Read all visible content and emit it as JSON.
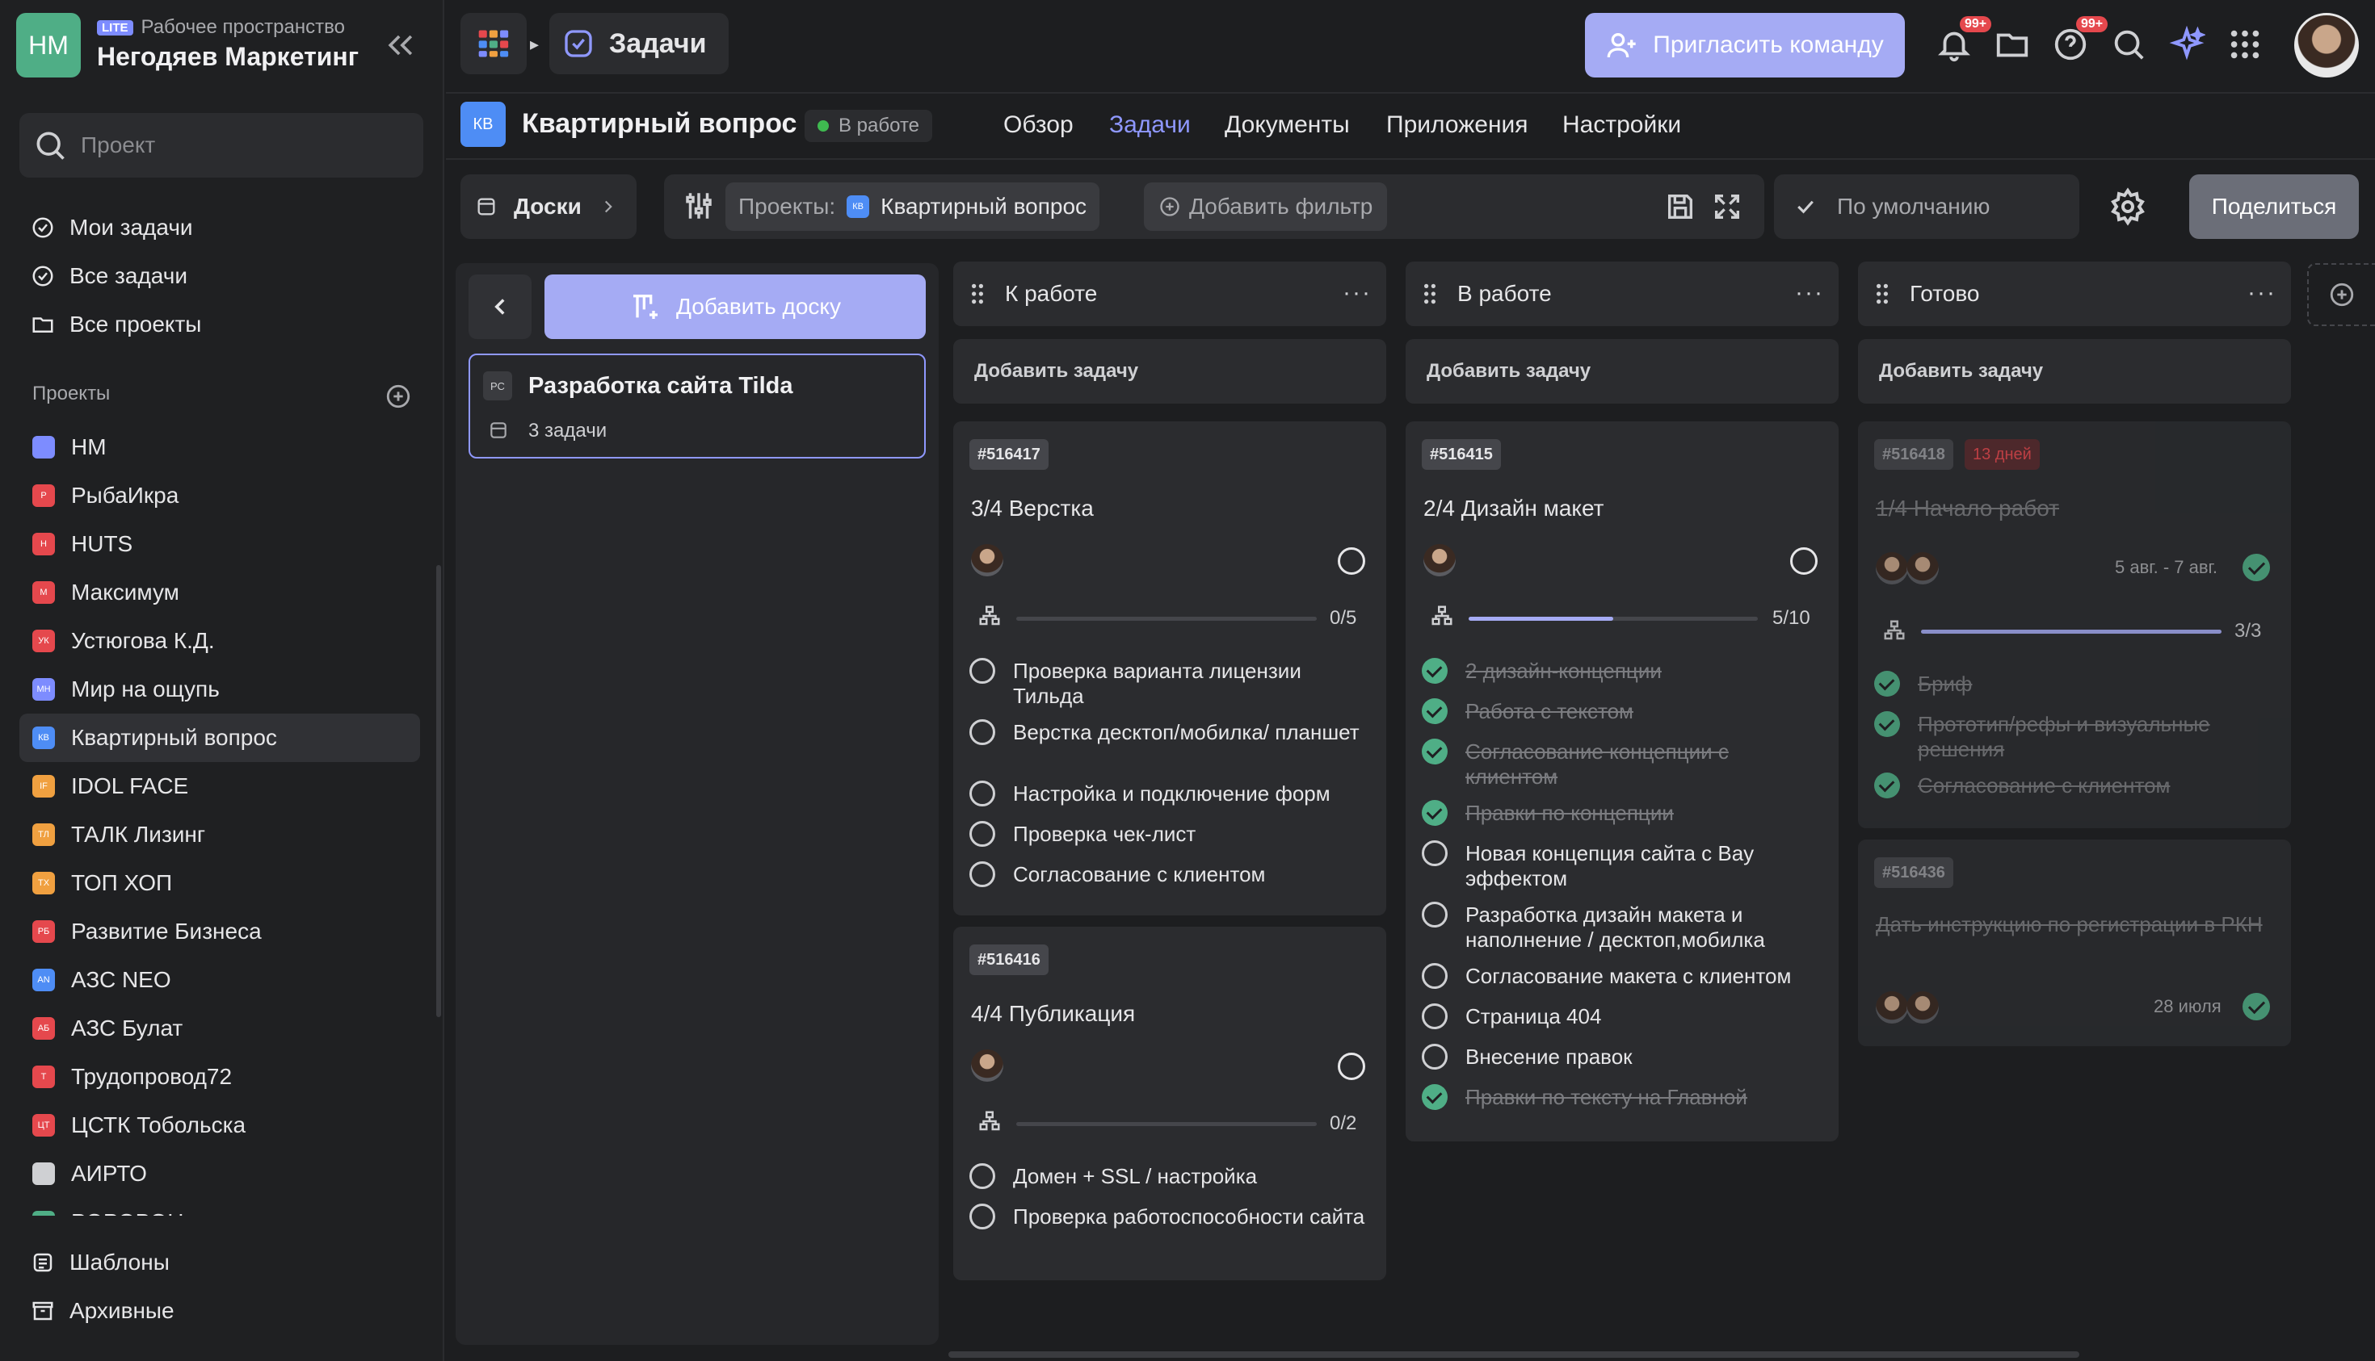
{
  "workspace": {
    "initials": "НМ",
    "badge": "LITE",
    "subtitle": "Рабочее пространство",
    "name": "Негодяев Маркетинг"
  },
  "sidebar": {
    "search_placeholder": "Проект",
    "nav": [
      {
        "label": "Мои задачи",
        "icon": "check-circle-icon"
      },
      {
        "label": "Все задачи",
        "icon": "check-circle-icon"
      },
      {
        "label": "Все проекты",
        "icon": "folder-icon"
      }
    ],
    "projects_heading": "Проекты",
    "projects": [
      {
        "label": "НМ",
        "abbr": "",
        "color": "#7d8cff"
      },
      {
        "label": "РыбаИкра",
        "abbr": "Р",
        "color": "#e5484d"
      },
      {
        "label": "HUTS",
        "abbr": "H",
        "color": "#e5484d"
      },
      {
        "label": "Максимум",
        "abbr": "М",
        "color": "#e5484d"
      },
      {
        "label": "Устюгова К.Д.",
        "abbr": "УК",
        "color": "#e5484d"
      },
      {
        "label": "Мир на ощупь",
        "abbr": "МН",
        "color": "#7d8cff"
      },
      {
        "label": "Квартирный вопрос",
        "abbr": "КВ",
        "color": "#4e8df5",
        "active": true
      },
      {
        "label": "IDOL FACE",
        "abbr": "IF",
        "color": "#f0a040"
      },
      {
        "label": "ТАЛК Лизинг",
        "abbr": "ТЛ",
        "color": "#f0a040"
      },
      {
        "label": "ТОП ХОП",
        "abbr": "ТХ",
        "color": "#f0a040"
      },
      {
        "label": "Развитие Бизнеса",
        "abbr": "РБ",
        "color": "#e5484d"
      },
      {
        "label": "АЗС NEO",
        "abbr": "AN",
        "color": "#4e8df5"
      },
      {
        "label": "АЗС Булат",
        "abbr": "АБ",
        "color": "#e5484d"
      },
      {
        "label": "Трудопровод72",
        "abbr": "Т",
        "color": "#e5484d"
      },
      {
        "label": "ЦСТК Тобольска",
        "abbr": "ЦТ",
        "color": "#e5484d"
      },
      {
        "label": "АИРТО",
        "abbr": "",
        "color": "#cfd0d3"
      },
      {
        "label": "РОРОВОН",
        "abbr": "",
        "color": "#4fae86"
      }
    ],
    "bottom": [
      {
        "label": "Шаблоны",
        "icon": "templates-icon"
      },
      {
        "label": "Архивные",
        "icon": "archive-icon"
      }
    ]
  },
  "topbar": {
    "section": "Задачи",
    "invite_label": "Пригласить команду",
    "notif_badge": "99+",
    "help_badge": "99+"
  },
  "project": {
    "badge": "КВ",
    "title": "Квартирный вопрос",
    "status": "В работе",
    "tabs": [
      "Обзор",
      "Задачи",
      "Документы",
      "Приложения",
      "Настройки"
    ],
    "active_tab": 1
  },
  "toolbar": {
    "boards_label": "Доски",
    "filter_projects_label": "Проекты:",
    "filter_project_badge": "КВ",
    "filter_project_value": "Квартирный вопрос",
    "add_filter_label": "Добавить фильтр",
    "view_label": "По умолчанию",
    "share_label": "Поделиться"
  },
  "boards": {
    "add_label": "Добавить доску",
    "items": [
      {
        "badge": "РС",
        "name": "Разработка сайта Tilda",
        "count": "3 задачи"
      }
    ]
  },
  "columns": [
    {
      "title": "К работе",
      "add_task": "Добавить задачу",
      "cards": [
        {
          "id": "#516417",
          "title": "3/4 Верстка",
          "progress_text": "0/5",
          "progress": 0,
          "subtasks": [
            {
              "text": "Проверка варианта лицензии Тильда",
              "done": false
            },
            {
              "text": "Верстка десктоп/мобилка/ планшет",
              "done": false
            },
            {
              "text": "Настройка и подключение форм",
              "done": false
            },
            {
              "text": "Проверка чек-лист",
              "done": false
            },
            {
              "text": "Согласование с клиентом",
              "done": false
            }
          ]
        },
        {
          "id": "#516416",
          "title": "4/4 Публикация",
          "progress_text": "0/2",
          "progress": 0,
          "subtasks": [
            {
              "text": "Домен + SSL / настройка",
              "done": false
            },
            {
              "text": "Проверка работоспособности сайта",
              "done": false
            }
          ]
        }
      ]
    },
    {
      "title": "В работе",
      "add_task": "Добавить задачу",
      "cards": [
        {
          "id": "#516415",
          "title": "2/4 Дизайн макет",
          "progress_text": "5/10",
          "progress": 0.5,
          "subtasks": [
            {
              "text": "2 дизайн-концепции",
              "done": true
            },
            {
              "text": "Работа с текстом",
              "done": true
            },
            {
              "text": "Согласование концепции с клиентом",
              "done": true
            },
            {
              "text": "Правки по концепции",
              "done": true
            },
            {
              "text": "Новая концепция сайта с Bay эффектом",
              "done": false
            },
            {
              "text": "Разработка дизайн макета и наполнение / десктоп,мобилка",
              "done": false
            },
            {
              "text": "Согласование макета с клиентом",
              "done": false
            },
            {
              "text": "Страница 404",
              "done": false
            },
            {
              "text": "Внесение правок",
              "done": false
            },
            {
              "text": "Правки по тексту на Главной",
              "done": true
            }
          ]
        }
      ]
    },
    {
      "title": "Готово",
      "add_task": "Добавить задачу",
      "cards": [
        {
          "id": "#516418",
          "overdue": "13 дней",
          "title": "1/4 Начало работ",
          "dates": "5 авг. - 7 авг.",
          "progress_text": "3/3",
          "progress": 1,
          "subtasks": [
            {
              "text": "Бриф",
              "done": true
            },
            {
              "text": "Прототип/рефы и визуальные решения",
              "done": true
            },
            {
              "text": "Согласование с клиентом",
              "done": true
            }
          ]
        },
        {
          "id": "#516436",
          "title": "Дать инструкцию по регистрации в РКН",
          "dates": "28 июля"
        }
      ]
    }
  ],
  "colors": {
    "accent": "#8f98ff",
    "button": "#a5abf4",
    "success": "#4fae86",
    "danger": "#e5484d"
  }
}
